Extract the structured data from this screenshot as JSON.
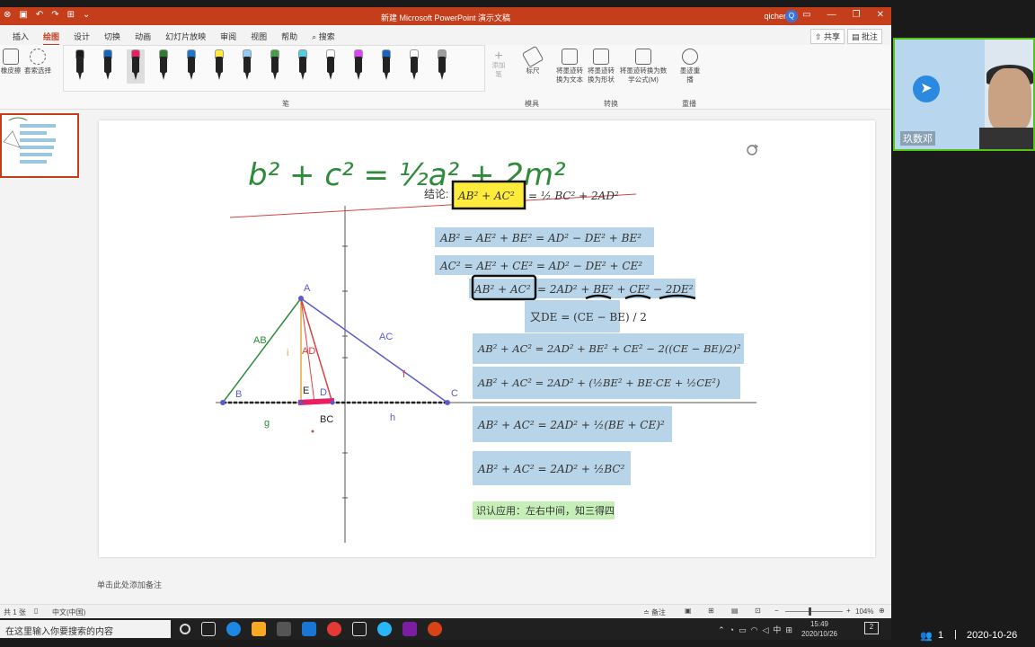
{
  "window": {
    "title": "新建 Microsoft PowerPoint 演示文稿",
    "user": "qicheng",
    "user_initial": "Q"
  },
  "menu": {
    "tabs": [
      "插入",
      "绘图",
      "设计",
      "切换",
      "动画",
      "幻灯片放映",
      "审阅",
      "视图",
      "帮助",
      "搜索"
    ],
    "active_tab": "绘图",
    "share": "共享",
    "comment": "批注"
  },
  "ribbon": {
    "eraser": "橡皮擦",
    "lasso": "套索选择",
    "pen_group": "笔",
    "add_pen": "添加笔",
    "ruler": "标尺",
    "template_group": "模具",
    "ink_to_text": "将墨迹转换为文本",
    "ink_to_shape": "将墨迹转换为形状",
    "ink_to_math": "将墨迹转换为数学公式(M)",
    "convert_group": "转换",
    "replay": "墨迹重播",
    "replay_group": "重播",
    "pen_colors": [
      "#1a1a1a",
      "#1565c0",
      "#e91e63",
      "#2e7d32",
      "#1976d2",
      "#ffeb3b",
      "#90caf9",
      "#43a047",
      "#4dd0e1",
      "#ffffff",
      "#e040fb",
      "#1565c0",
      "#ffffff",
      "#9e9e9e"
    ]
  },
  "slide": {
    "conclusion_label": "结论:",
    "eq_conclusion_left": "AB² + AC²",
    "eq_conclusion_right": "= ½ BC² + 2AD²",
    "eq1": "AB² = AE² + BE² = AD² − DE² + BE²",
    "eq2": "AC² = AE² + CE² = AD² − DE² + CE²",
    "eq3_left": "AB² + AC²",
    "eq3_right": "= 2AD² + BE² + CE² − 2DE²",
    "eq4": "又DE = (CE − BE) / 2",
    "eq5": "AB² + AC² = 2AD² + BE² + CE² − 2((CE − BE)/2)²",
    "eq6": "AB² + AC² = 2AD² + (½BE² + BE·CE + ½CE²)",
    "eq7": "AB² + AC² = 2AD² + ½(BE + CE)²",
    "eq8": "AB² + AC² = 2AD² + ½BC²",
    "note": "识认应用：左右中间，知三得四",
    "handwriting": "b² + c² = ½a² + 2m²",
    "labels": {
      "A": "A",
      "B": "B",
      "C": "C",
      "D": "D",
      "E": "E",
      "AB": "AB",
      "AC": "AC",
      "AD": "AD",
      "BC": "BC",
      "g": "g",
      "h": "h",
      "i": "i",
      "f": "f"
    }
  },
  "notes": "单击此处添加备注",
  "status": {
    "slide_count": "共 1 张",
    "language": "中文(中国)",
    "notes_btn": "备注",
    "zoom": "104%"
  },
  "taskbar": {
    "search_placeholder": "在这里输入你要搜索的内容",
    "time": "15:49",
    "date": "2020/10/26",
    "ime": "中",
    "notifications": "2"
  },
  "video": {
    "name": "玖数邓"
  },
  "side_status": {
    "participants": "1",
    "date": "2020-10-26"
  }
}
